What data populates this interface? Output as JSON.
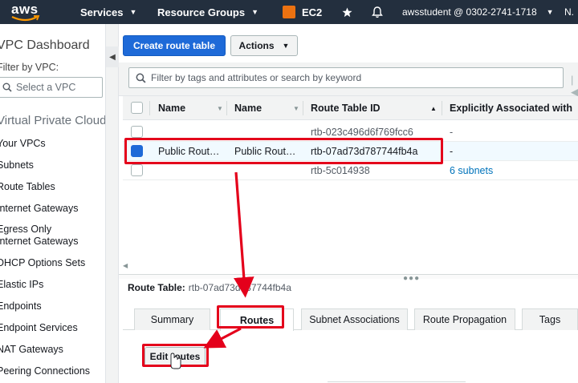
{
  "topnav": {
    "logo": "aws",
    "services": "Services",
    "resource_groups": "Resource Groups",
    "ec2": "EC2",
    "account": "awsstudent @ 0302-2741-1718",
    "region": "N."
  },
  "sidebar": {
    "title": "VPC Dashboard",
    "filter_label": "Filter by VPC:",
    "vpc_placeholder": "Select a VPC",
    "section": "Virtual Private Cloud",
    "items": [
      "Your VPCs",
      "Subnets",
      "Route Tables",
      "Internet Gateways",
      "Egress Only Internet Gateways",
      "DHCP Options Sets",
      "Elastic IPs",
      "Endpoints",
      "Endpoint Services",
      "NAT Gateways",
      "Peering Connections"
    ]
  },
  "toolbar": {
    "create_label": "Create route table",
    "actions_label": "Actions"
  },
  "filter": {
    "placeholder": "Filter by tags and attributes or search by keyword"
  },
  "table": {
    "columns": [
      "Name",
      "Name",
      "Route Table ID",
      "Explicitly Associated with"
    ],
    "rows": [
      {
        "name1": "",
        "name2": "",
        "id": "rtb-023c496d6f769fcc6",
        "assoc": "-",
        "selected": false
      },
      {
        "name1": "Public Rout…",
        "name2": "Public Rout…",
        "id": "rtb-07ad73d787744fb4a",
        "assoc": "-",
        "selected": true
      },
      {
        "name1": "",
        "name2": "",
        "id": "rtb-5c014938",
        "assoc": "6 subnets",
        "selected": false
      }
    ]
  },
  "detail": {
    "label": "Route Table:",
    "value": "rtb-07ad73d787744fb4a",
    "tabs": [
      "Summary",
      "Routes",
      "Subnet Associations",
      "Route Propagation",
      "Tags"
    ],
    "active_tab": "Routes",
    "edit_routes_label": "Edit routes"
  },
  "colors": {
    "nav_bg": "#232f3e",
    "primary": "#1e6ad8",
    "annotation": "#e4001b",
    "link": "#0073bb"
  }
}
